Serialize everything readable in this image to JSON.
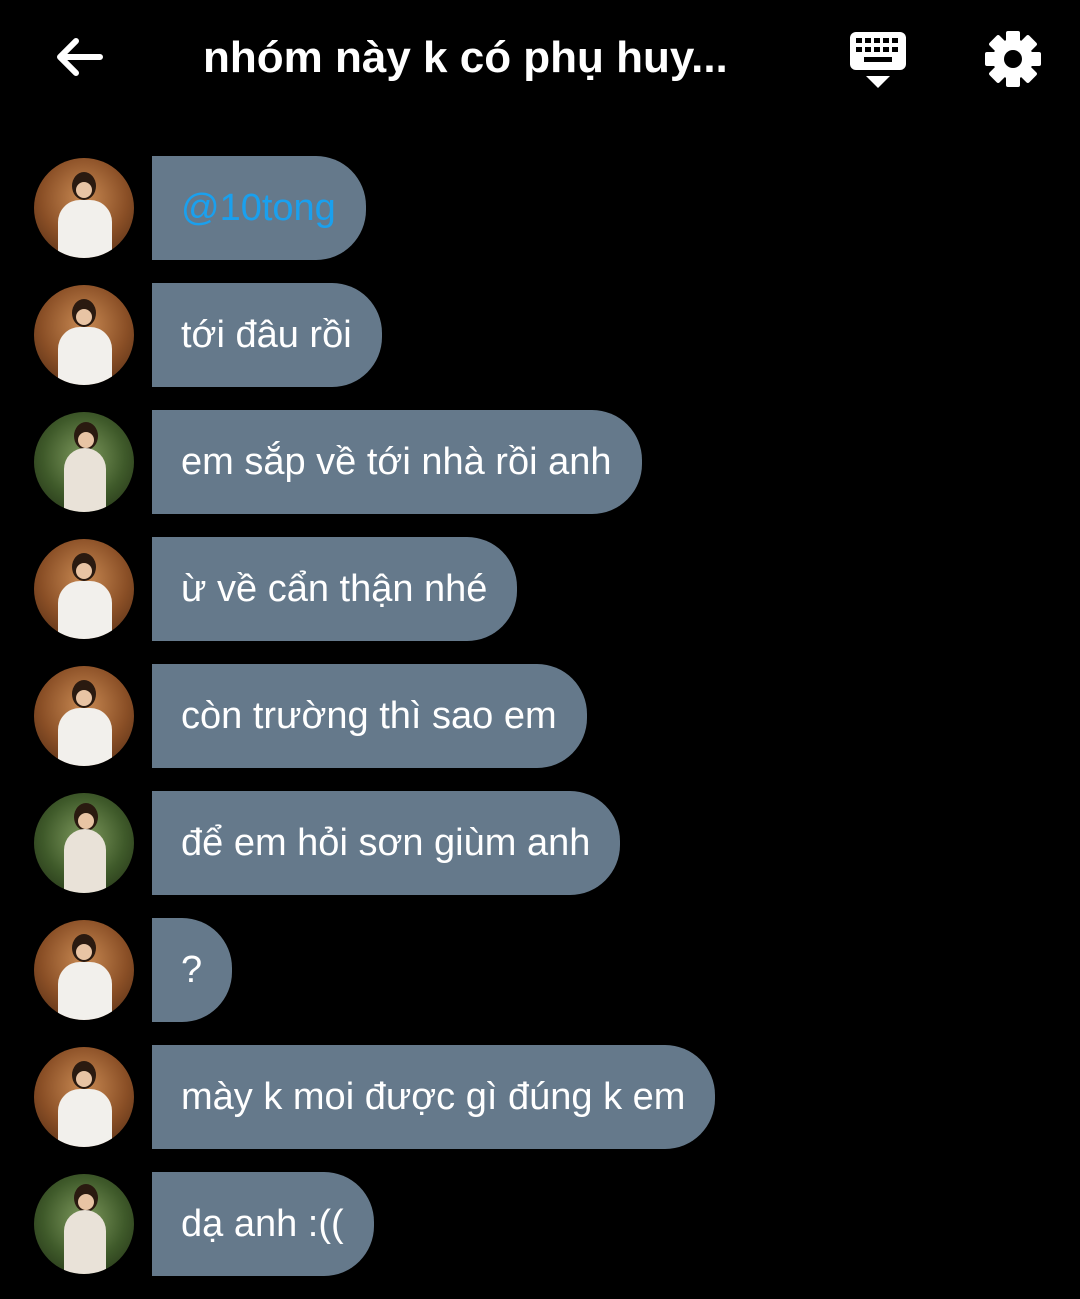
{
  "header": {
    "title": "nhóm này k có phụ huy..."
  },
  "colors": {
    "background": "#000000",
    "bubble": "#65798b",
    "mention": "#1aa0ee",
    "text": "#ffffff"
  },
  "messages": [
    {
      "sender_avatar": "avatar-a",
      "text": "@10tong",
      "mention": true
    },
    {
      "sender_avatar": "avatar-a",
      "text": "tới đâu rồi"
    },
    {
      "sender_avatar": "avatar-b",
      "text": "em sắp về tới nhà rồi anh"
    },
    {
      "sender_avatar": "avatar-a",
      "text": "ừ về cẩn thận nhé"
    },
    {
      "sender_avatar": "avatar-a",
      "text": "còn trường thì sao em"
    },
    {
      "sender_avatar": "avatar-b",
      "text": "để em hỏi sơn giùm anh"
    },
    {
      "sender_avatar": "avatar-a",
      "text": "?"
    },
    {
      "sender_avatar": "avatar-a",
      "text": "mày k moi được gì đúng k em"
    },
    {
      "sender_avatar": "avatar-b",
      "text": "dạ anh :(("
    }
  ]
}
